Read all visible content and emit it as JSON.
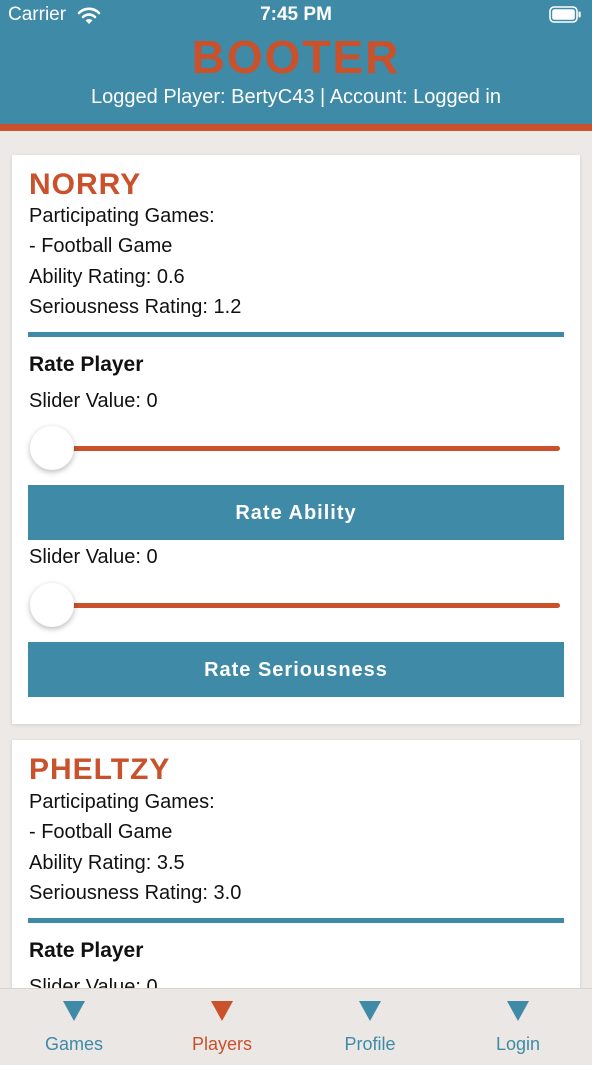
{
  "status_bar": {
    "carrier": "Carrier",
    "time": "7:45 PM",
    "wifi_icon": "wifi-icon",
    "battery_icon": "battery-icon"
  },
  "header": {
    "title": "BOOTER",
    "status": "Logged Player: BertyC43 | Account: Logged in"
  },
  "colors": {
    "primary": "#3f8aa7",
    "accent": "#c9512b",
    "background": "#ede9e6"
  },
  "players": [
    {
      "name": "NORRY",
      "games_label": "Participating Games:",
      "games": [
        "- Football Game"
      ],
      "ability_rating": "Ability Rating: 0.6",
      "seriousness_rating": "Seriousness Rating: 1.2",
      "rate_title": "Rate Player",
      "ability_slider_value": "Slider Value: 0",
      "ability_slider_level": 0,
      "rate_ability_label": "Rate Ability",
      "seriousness_slider_value": "Slider Value: 0",
      "seriousness_slider_level": 0,
      "rate_seriousness_label": "Rate Seriousness"
    },
    {
      "name": "PHELTZY",
      "games_label": "Participating Games:",
      "games": [
        "- Football Game"
      ],
      "ability_rating": "Ability Rating: 3.5",
      "seriousness_rating": "Seriousness Rating: 3.0",
      "rate_title": "Rate Player",
      "ability_slider_value": "Slider Value: 0"
    }
  ],
  "tabs": [
    {
      "label": "Games",
      "icon": "triangle-down-icon",
      "active": false
    },
    {
      "label": "Players",
      "icon": "triangle-down-icon",
      "active": true
    },
    {
      "label": "Profile",
      "icon": "triangle-down-icon",
      "active": false
    },
    {
      "label": "Login",
      "icon": "triangle-down-icon",
      "active": false
    }
  ]
}
